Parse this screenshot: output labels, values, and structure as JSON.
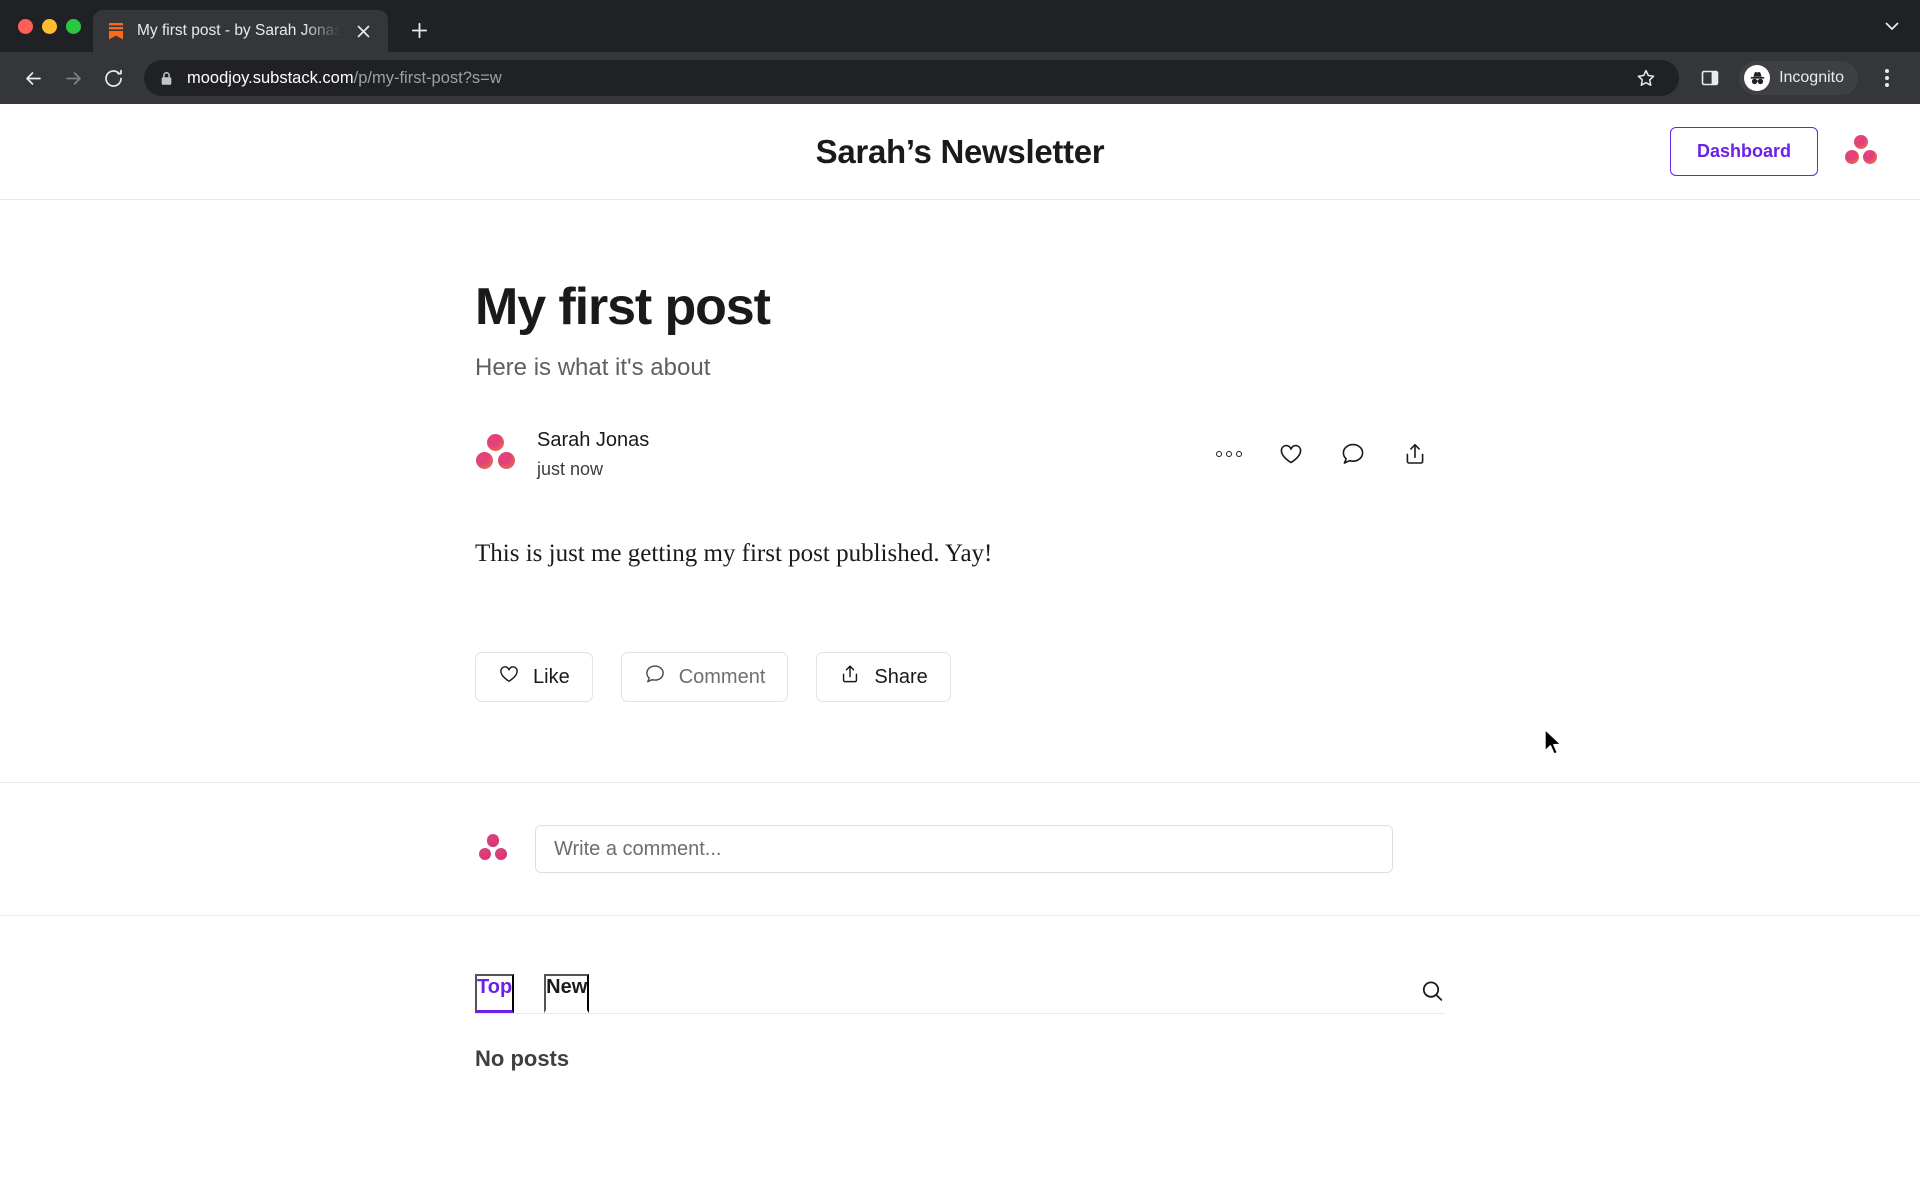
{
  "browser": {
    "tab": {
      "title": "My first post - by Sarah Jonas",
      "favicon": "substack-bookmark-icon",
      "close_icon": "close-icon"
    },
    "new_tab_icon": "plus-icon",
    "tab_list_icon": "chevron-down-icon",
    "nav": {
      "back_icon": "back-arrow-icon",
      "forward_icon": "forward-arrow-icon",
      "reload_icon": "reload-icon"
    },
    "omnibox": {
      "lock_icon": "lock-icon",
      "url_host": "moodjoy.substack.com",
      "url_path": "/p/my-first-post?s=w",
      "bookmark_icon": "star-icon",
      "side_panel_icon": "side-panel-icon"
    },
    "profile": {
      "label": "Incognito",
      "icon": "incognito-hat-icon"
    },
    "menu_icon": "kebab-menu-icon"
  },
  "site": {
    "title": "Sarah’s Newsletter",
    "dashboard_label": "Dashboard",
    "avatar_icon": "substack-profile-avatar",
    "accent_color": "#6b21e8"
  },
  "post": {
    "title": "My first post",
    "subtitle": "Here is what it's about",
    "author": "Sarah Jonas",
    "timestamp": "just now",
    "body": "This is just me getting my first post published. Yay!",
    "author_avatar_icon": "author-avatar",
    "meta_actions": [
      {
        "name": "more-options-icon",
        "icon": "three-dots-icon"
      },
      {
        "name": "like-icon",
        "icon": "heart-icon"
      },
      {
        "name": "comment-icon",
        "icon": "speech-bubble-icon"
      },
      {
        "name": "share-icon",
        "icon": "share-arrow-icon"
      }
    ],
    "actions": [
      {
        "label": "Like",
        "icon": "heart-icon"
      },
      {
        "label": "Comment",
        "icon": "speech-bubble-icon"
      },
      {
        "label": "Share",
        "icon": "share-arrow-icon"
      }
    ]
  },
  "comment_box": {
    "placeholder": "Write a comment...",
    "value": "",
    "avatar_icon": "commenter-avatar"
  },
  "posts_section": {
    "tabs": [
      {
        "label": "Top",
        "active": true
      },
      {
        "label": "New",
        "active": false
      }
    ],
    "search_icon": "search-icon",
    "empty_state": "No posts"
  }
}
